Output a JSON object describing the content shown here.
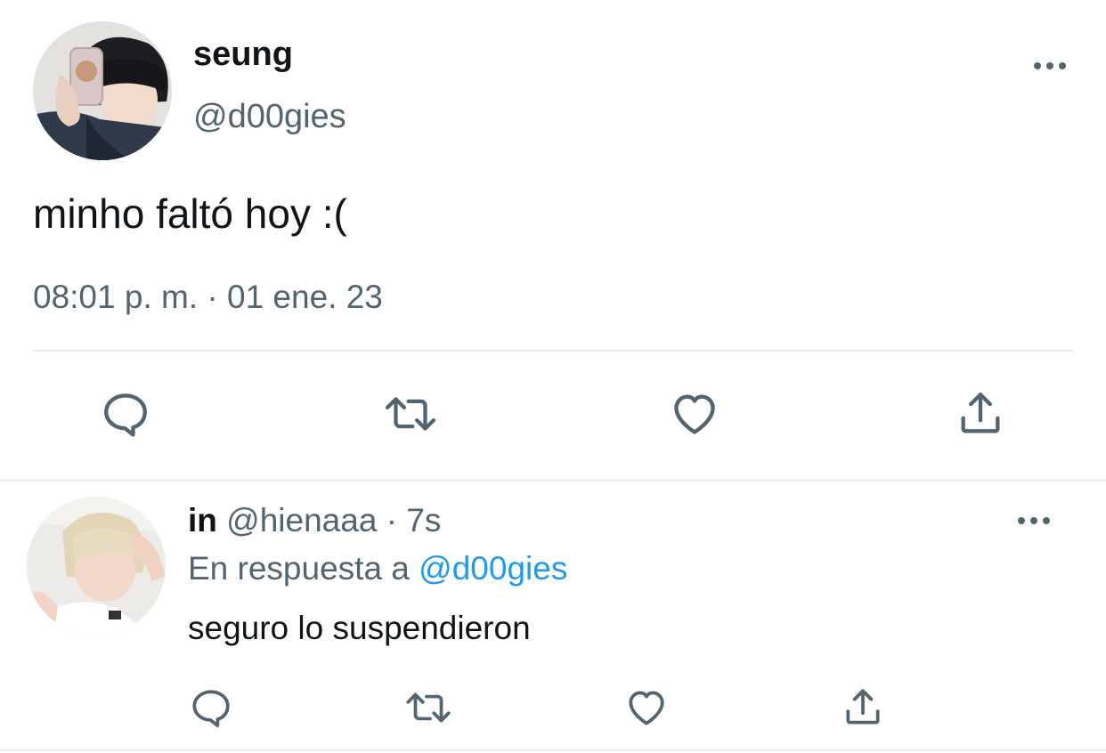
{
  "main_tweet": {
    "display_name": "seung",
    "handle": "@d00gies",
    "more_label": "•••",
    "text": "minho faltó hoy :(",
    "timestamp": "08:01 p. m. · 01 ene. 23",
    "avatar_icon": "profile-photo-icon",
    "actions": [
      "reply-icon",
      "retweet-icon",
      "like-icon",
      "share-icon"
    ]
  },
  "reply_tweet": {
    "display_name": "in",
    "handle": "@hienaaa",
    "separator": "·",
    "time": "7s",
    "more_label": "•••",
    "in_reply_to_label": "En respuesta a",
    "in_reply_to_handle": "@d00gies",
    "text": "seguro lo suspendieron",
    "avatar_icon": "profile-photo-icon",
    "actions": [
      "reply-icon",
      "retweet-icon",
      "like-icon",
      "share-icon"
    ]
  },
  "colors": {
    "text_primary": "#0f1419",
    "text_secondary": "#536471",
    "link": "#1d9bf0",
    "divider": "#e6ebee"
  }
}
